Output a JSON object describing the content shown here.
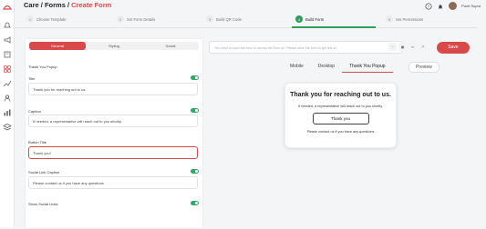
{
  "breadcrumb": {
    "part1": "Care",
    "part2": "Forms",
    "part3": "Create Form",
    "sep": "/"
  },
  "user": {
    "name": "Punit Supra"
  },
  "steps": [
    {
      "num": "1",
      "label": "Choose Template"
    },
    {
      "num": "2",
      "label": "Set Form Details"
    },
    {
      "num": "3",
      "label": "Build QR Code"
    },
    {
      "num": "4",
      "label": "Build Form"
    },
    {
      "num": "5",
      "label": "Set Permissions"
    }
  ],
  "editor_tabs": [
    "General",
    "Styling",
    "Social"
  ],
  "panel": {
    "section": "Thank You Popup",
    "title_label": "Title",
    "title_value": "Thank you for reaching out to us.",
    "caption_label": "Caption",
    "caption_value": "If needed, a representative will reach out to you shortly.",
    "button_label": "Button Title",
    "button_value": "Thank you!",
    "social_label": "Social Link Caption",
    "social_value": "Please contact us if you have any questions",
    "show_social_label": "Show Social Links"
  },
  "url": {
    "placeholder": "You need to save the form to access the form url. Please save the form to get link url"
  },
  "save_label": "Save",
  "view_tabs": [
    "Mobile",
    "Desktop",
    "Thank You Popup"
  ],
  "preview_label": "Preview",
  "popup": {
    "title": "Thank you for reaching out to us.",
    "caption": "If needed, a representative will reach out to you shortly.",
    "button": "Thank you",
    "social": "Please contact us if you have any questions"
  },
  "colors": {
    "accent": "#d84a4a",
    "active_step": "#2f9e5b",
    "toggle": "#2fa86a"
  }
}
